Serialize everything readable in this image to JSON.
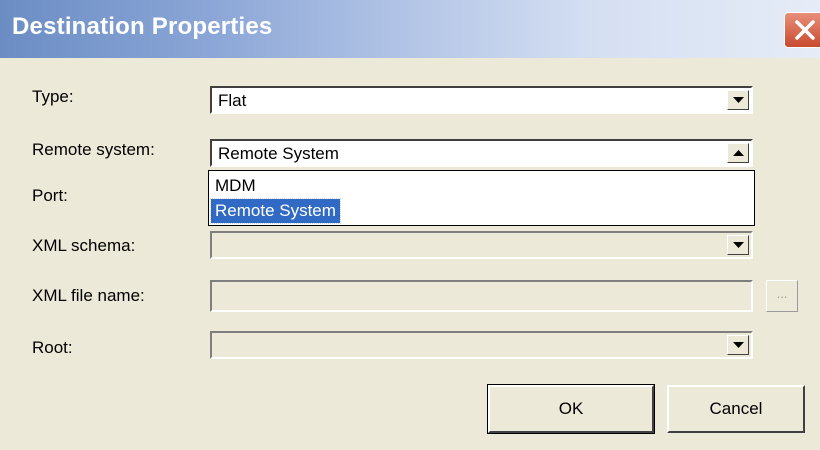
{
  "window": {
    "title": "Destination Properties",
    "close_icon": "close-icon"
  },
  "fields": {
    "type": {
      "label": "Type:",
      "value": "Flat"
    },
    "remote_system": {
      "label": "Remote system:",
      "value": "Remote System",
      "options": [
        "MDM",
        "Remote System"
      ],
      "selected": "Remote System"
    },
    "port": {
      "label": "Port:"
    },
    "xml_schema": {
      "label": "XML schema:",
      "value": ""
    },
    "xml_file_name": {
      "label": "XML file name:",
      "value": "",
      "browse_label": "..."
    },
    "root": {
      "label": "Root:",
      "value": ""
    }
  },
  "buttons": {
    "ok": "OK",
    "cancel": "Cancel"
  },
  "colors": {
    "selection": "#316ac5",
    "dialog_bg": "#ece9d8",
    "close_button": "#c94a2f"
  }
}
